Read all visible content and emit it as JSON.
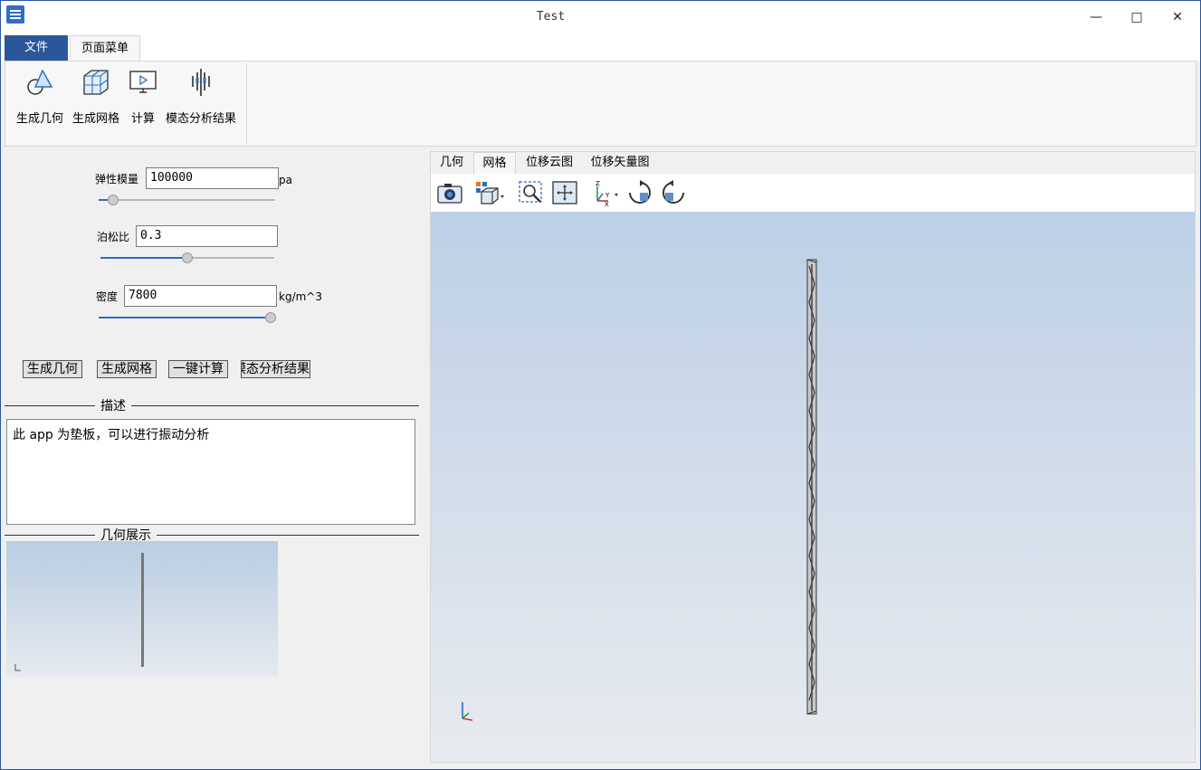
{
  "window": {
    "title": "Test",
    "controls": [
      "—",
      "□",
      "✕"
    ]
  },
  "menu": {
    "tabs": [
      "文件",
      "页面菜单"
    ]
  },
  "ribbon": {
    "buttons": [
      {
        "label": "生成几何",
        "icon": "geometry-icon"
      },
      {
        "label": "生成网格",
        "icon": "mesh-icon"
      },
      {
        "label": "计算",
        "icon": "compute-icon"
      },
      {
        "label": "模态分析结果",
        "icon": "modal-result-icon"
      }
    ]
  },
  "params": {
    "elastic": {
      "label": "弹性模量",
      "value": "100000",
      "unit": "pa",
      "slider": 0.08
    },
    "poisson": {
      "label": "泊松比",
      "value": "0.3",
      "unit": "",
      "slider": 0.5
    },
    "density": {
      "label": "密度",
      "value": "7800",
      "unit": "kg/m^3",
      "slider": 0.99
    }
  },
  "actions": [
    "生成几何",
    "生成网格",
    "一键计算",
    "模态分析结果"
  ],
  "description": {
    "title": "描述",
    "text": "此 app 为垫板，可以进行振动分析"
  },
  "preview": {
    "title": "几何展示"
  },
  "view": {
    "tabs": [
      "几何",
      "网格",
      "位移云图",
      "位移矢量图"
    ],
    "active_tab": "网格",
    "toolbar": [
      "camera-icon",
      "view-mode-icon",
      "zoom-box-icon",
      "fit-view-icon",
      "axes-icon",
      "rotate-cw-icon",
      "rotate-ccw-icon"
    ]
  },
  "colors": {
    "accent": "#2b579a",
    "slider_fill": "#2b6ec2"
  }
}
